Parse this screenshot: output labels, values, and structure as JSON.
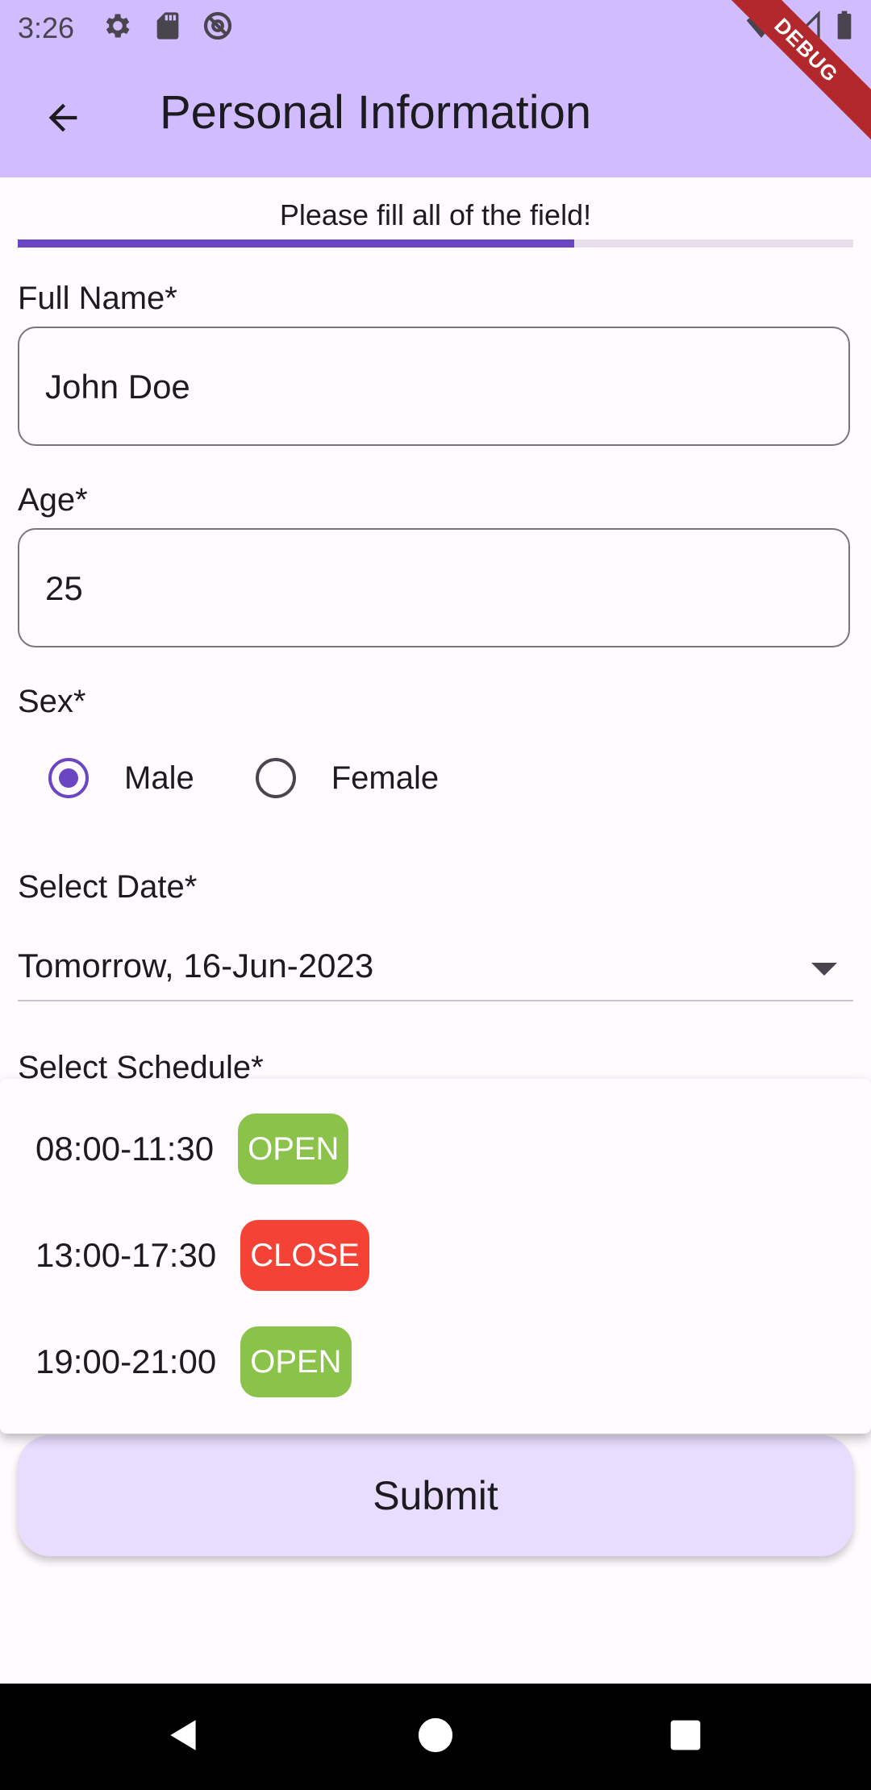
{
  "status_bar": {
    "time": "3:26"
  },
  "app_bar": {
    "title": "Personal Information",
    "debug_label": "DEBUG"
  },
  "form": {
    "hint": "Please fill all of the field!",
    "progress": 0.666,
    "full_name": {
      "label": "Full Name*",
      "value": "John Doe"
    },
    "age": {
      "label": "Age*",
      "value": "25"
    },
    "sex": {
      "label": "Sex*",
      "options": [
        "Male",
        "Female"
      ],
      "selected": "Male"
    },
    "date": {
      "label": "Select Date*",
      "value": "Tomorrow, 16-Jun-2023"
    },
    "schedule": {
      "label": "Select Schedule*",
      "options": [
        {
          "time": "08:00-11:30",
          "status": "OPEN"
        },
        {
          "time": "13:00-17:30",
          "status": "CLOSE"
        },
        {
          "time": "19:00-21:00",
          "status": "OPEN"
        }
      ]
    },
    "submit_label": "Submit"
  },
  "colors": {
    "primary": "#6a46c2",
    "app_bar": "#d0bcff",
    "open": "#8bc34a",
    "close": "#f44336"
  }
}
